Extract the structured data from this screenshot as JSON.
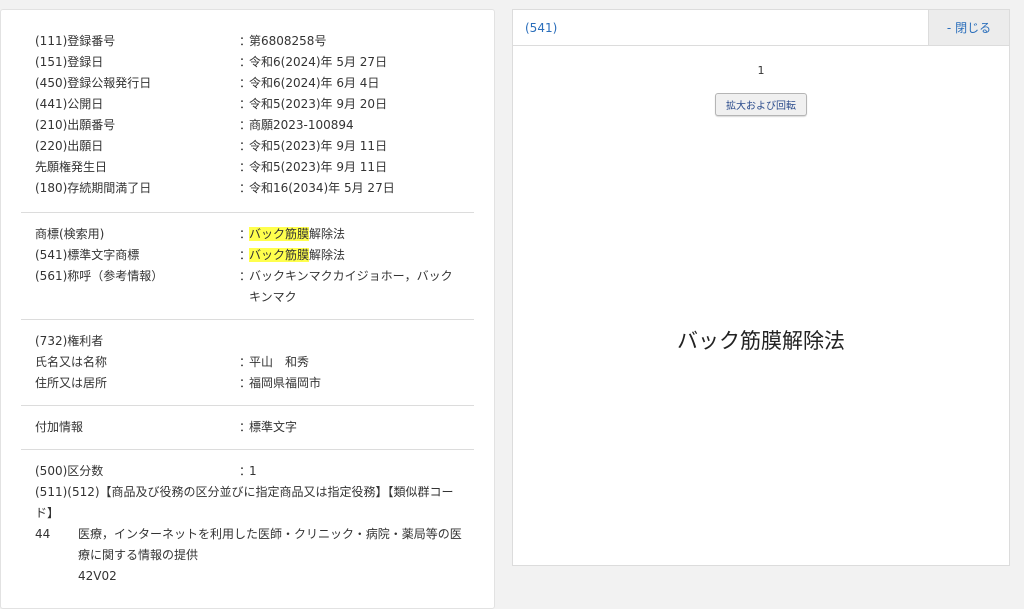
{
  "bibliographic": [
    {
      "label": "(111)登録番号",
      "value": "第6808258号"
    },
    {
      "label": "(151)登録日",
      "value": "令和6(2024)年 5月 27日"
    },
    {
      "label": "(450)登録公報発行日",
      "value": "令和6(2024)年 6月 4日"
    },
    {
      "label": "(441)公開日",
      "value": "令和5(2023)年 9月 20日"
    },
    {
      "label": "(210)出願番号",
      "value": "商願2023-100894"
    },
    {
      "label": "(220)出願日",
      "value": "令和5(2023)年 9月 11日"
    },
    {
      "label": "先願権発生日",
      "value": "令和5(2023)年 9月 11日"
    },
    {
      "label": "(180)存続期間満了日",
      "value": "令和16(2034)年 5月 27日"
    }
  ],
  "separator": "：",
  "trademark": {
    "search_label": "商標(検索用)",
    "search_highlight": "バック筋膜",
    "search_rest": "解除法",
    "standard_label": "(541)標準文字商標",
    "standard_highlight": "バック筋膜",
    "standard_rest": "解除法",
    "reading_label": "(561)称呼（参考情報）",
    "reading_value": "バックキンマクカイジョホー，バック\nキンマク"
  },
  "owner": {
    "heading": "(732)権利者",
    "name_label": "氏名又は名称",
    "name_value": "平山　和秀",
    "address_label": "住所又は居所",
    "address_value": "福岡県福岡市"
  },
  "additional": {
    "label": "付加情報",
    "value": "標準文字"
  },
  "classification": {
    "count_label": "(500)区分数",
    "count_value": "1",
    "goods_heading": "(511)(512)【商品及び役務の区分並びに指定商品又は指定役務】【類似群コー\nド】",
    "class_number": "44",
    "class_text": "医療，インターネットを利用した医師・クリニック・病院・薬局等の医\n療に関する情報の提供",
    "similar_code": "42V02"
  },
  "viewer": {
    "title": "(541)",
    "close_label": "- 閉じる",
    "page_number": "1",
    "zoom_button": "拡大および回転",
    "mark_text": "バック筋膜解除法"
  },
  "colors": {
    "highlight": "#ffff4d",
    "link": "#2a6ebb"
  }
}
